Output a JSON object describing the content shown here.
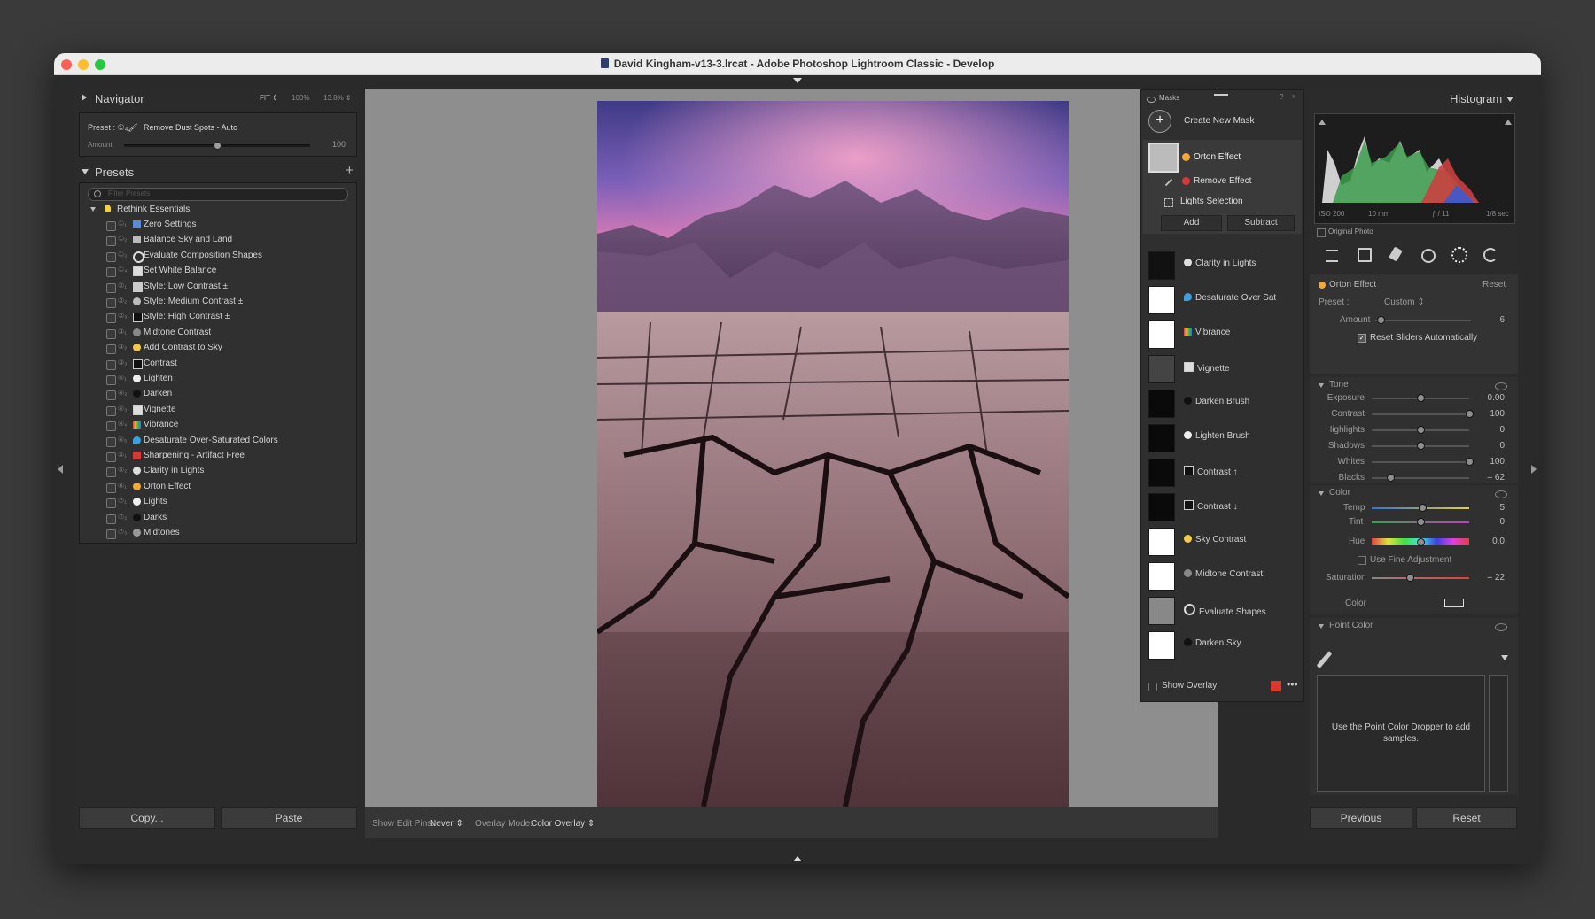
{
  "window": {
    "title": "David Kingham-v13-3.lrcat - Adobe Photoshop Lightroom Classic - Develop"
  },
  "navigator": {
    "label": "Navigator",
    "fit": "FIT ⇕",
    "zoom1": "100%",
    "zoom2": "13.8% ⇕"
  },
  "quick_preset": {
    "label": "Preset : ①₄🖌",
    "value": "Remove Dust Spots - Auto",
    "amount_label": "Amount",
    "amount_value": "100",
    "amount_level": 0.5
  },
  "presets": {
    "label": "Presets",
    "add": "+",
    "filter_placeholder": "Filter Presets",
    "group": "Rethink Essentials",
    "items": [
      {
        "num": "①₁",
        "label": "Zero Settings",
        "icon": "zero-icon",
        "color": "#5b8bd6"
      },
      {
        "num": "①₂",
        "label": "Balance Sky and Land",
        "icon": "landscape-icon",
        "color": "#bbbbbb"
      },
      {
        "num": "①₃",
        "label": "Evaluate Composition Shapes",
        "icon": "eye-icon",
        "color": "#dddddd"
      },
      {
        "num": "①₄",
        "label": "Set White Balance",
        "icon": "square-icon",
        "color": "#dddddd"
      },
      {
        "num": "②₁",
        "label": "Style: Low Contrast ±",
        "icon": "square-icon",
        "color": "#cccccc"
      },
      {
        "num": "②₂",
        "label": "Style: Medium Contrast ±",
        "icon": "circle-icon",
        "color": "#bbbbbb"
      },
      {
        "num": "②₃",
        "label": "Style: High Contrast ±",
        "icon": "square-icon",
        "color": "#111111"
      },
      {
        "num": "③₁",
        "label": "Midtone Contrast",
        "icon": "circle-icon",
        "color": "#888888"
      },
      {
        "num": "③₂",
        "label": "Add Contrast to Sky",
        "icon": "sun-icon",
        "color": "#f3c94a"
      },
      {
        "num": "③₃",
        "label": "Contrast",
        "icon": "square-icon",
        "color": "#111111"
      },
      {
        "num": "④₁",
        "label": "Lighten",
        "icon": "circle-icon",
        "color": "#eeeeee"
      },
      {
        "num": "④₂",
        "label": "Darken",
        "icon": "circle-icon",
        "color": "#111111"
      },
      {
        "num": "④₃",
        "label": "Vignette",
        "icon": "square-icon",
        "color": "#dddddd"
      },
      {
        "num": "④₄",
        "label": "Vibrance",
        "icon": "rainbow-icon",
        "color": "#e07a3a"
      },
      {
        "num": "④₅",
        "label": "Desaturate Over-Saturated Colors",
        "icon": "drop-icon",
        "color": "#3aa0e0"
      },
      {
        "num": "⑤₁",
        "label": "Sharpening - Artifact Free",
        "icon": "pin-icon",
        "color": "#d43a3a"
      },
      {
        "num": "⑤₂",
        "label": "Clarity in Lights",
        "icon": "circle-icon",
        "color": "#dddddd"
      },
      {
        "num": "⑥₁",
        "label": "Orton Effect",
        "icon": "sun-icon",
        "color": "#f3a83a"
      },
      {
        "num": "⑦₁",
        "label": "Lights",
        "icon": "circle-icon",
        "color": "#eeeeee"
      },
      {
        "num": "⑦₂",
        "label": "Darks",
        "icon": "circle-icon",
        "color": "#111111"
      },
      {
        "num": "⑦₃",
        "label": "Midtones",
        "icon": "circle-icon",
        "color": "#999999"
      }
    ]
  },
  "left_buttons": {
    "copy": "Copy...",
    "paste": "Paste"
  },
  "toolbar": {
    "edit_pins_label": "Show Edit Pins:",
    "edit_pins_value": "Never ⇕",
    "overlay_label": "Overlay Mode:",
    "overlay_value": "Color Overlay ⇕"
  },
  "masks": {
    "title": "Masks",
    "create": "Create New Mask",
    "active": "Orton Effect",
    "sub1": "Remove Effect",
    "sub2": "Lights Selection",
    "add": "Add",
    "subtract": "Subtract",
    "list": [
      {
        "label": "Clarity in Lights",
        "icon": "circle-icon",
        "color": "#dddddd",
        "thumb": "#111111"
      },
      {
        "label": "Desaturate Over Sat",
        "icon": "drop-icon",
        "color": "#3aa0e0",
        "thumb": "#ffffff"
      },
      {
        "label": "Vibrance",
        "icon": "rainbow-icon",
        "color": "#e07a3a",
        "thumb": "#ffffff"
      },
      {
        "label": "Vignette",
        "icon": "square-icon",
        "color": "#dddddd",
        "thumb": "#444444"
      },
      {
        "label": "Darken Brush",
        "icon": "circle-icon",
        "color": "#111111",
        "thumb": "#0a0a0a"
      },
      {
        "label": "Lighten Brush",
        "icon": "circle-icon",
        "color": "#eeeeee",
        "thumb": "#0a0a0a"
      },
      {
        "label": "Contrast ↑",
        "icon": "square-icon",
        "color": "#111111",
        "thumb": "#0a0a0a"
      },
      {
        "label": "Contrast ↓",
        "icon": "square-icon",
        "color": "#111111",
        "thumb": "#0a0a0a"
      },
      {
        "label": "Sky Contrast",
        "icon": "sun-icon",
        "color": "#f3c94a",
        "thumb": "#ffffff"
      },
      {
        "label": "Midtone Contrast",
        "icon": "circle-icon",
        "color": "#888888",
        "thumb": "#ffffff"
      },
      {
        "label": "Evaluate Shapes",
        "icon": "eye-icon",
        "color": "#dddddd",
        "thumb": "#888888"
      },
      {
        "label": "Darken Sky",
        "icon": "circle-icon",
        "color": "#111111",
        "thumb": "#ffffff"
      }
    ],
    "show_overlay": "Show Overlay",
    "overlay_color": "#d9372b"
  },
  "histogram": {
    "label": "Histogram",
    "iso": "ISO 200",
    "focal": "10 mm",
    "aperture": "ƒ / 11",
    "shutter": "1/8 sec",
    "original": "Original Photo"
  },
  "mask_panel": {
    "name": "Orton Effect",
    "reset": "Reset",
    "preset_label": "Preset :",
    "preset_value": "Custom ⇕",
    "amount_label": "Amount",
    "amount_value": "6",
    "amount_level": 0.06,
    "reset_auto": "Reset Sliders Automatically",
    "tone_label": "Tone",
    "tone": [
      {
        "label": "Exposure",
        "value": "0.00",
        "level": 0.5
      },
      {
        "label": "Contrast",
        "value": "100",
        "level": 1.0
      },
      {
        "label": "Highlights",
        "value": "0",
        "level": 0.5
      },
      {
        "label": "Shadows",
        "value": "0",
        "level": 0.5
      },
      {
        "label": "Whites",
        "value": "100",
        "level": 1.0
      },
      {
        "label": "Blacks",
        "value": "– 62",
        "level": 0.19
      }
    ],
    "color_label": "Color",
    "temp": {
      "label": "Temp",
      "value": "5",
      "level": 0.52
    },
    "tint": {
      "label": "Tint",
      "value": "0",
      "level": 0.5
    },
    "hue": {
      "label": "Hue",
      "value": "0.0",
      "level": 0.5
    },
    "fine": "Use Fine Adjustment",
    "saturation": {
      "label": "Saturation",
      "value": "– 22",
      "level": 0.39
    },
    "color_swatch": "Color",
    "point_color": "Point Color",
    "point_hint": "Use the Point Color Dropper to add samples."
  },
  "right_buttons": {
    "previous": "Previous",
    "reset": "Reset"
  }
}
